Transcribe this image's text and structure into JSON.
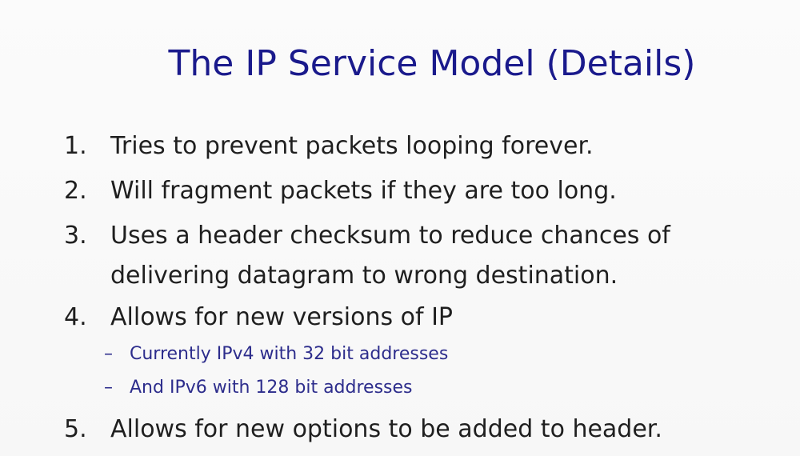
{
  "slide": {
    "title": "The IP Service Model (Details)",
    "items": [
      {
        "number": "1.",
        "text": "Tries to prevent packets looping forever."
      },
      {
        "number": "2.",
        "text": "Will fragment packets if they are too long."
      },
      {
        "number": "3.",
        "lines": [
          "Uses a header checksum to reduce chances of",
          "delivering datagram to wrong destination."
        ]
      },
      {
        "number": "4.",
        "text": "Allows for new versions of IP"
      },
      {
        "number": "5.",
        "text": "Allows for new options to be added to header."
      }
    ],
    "sub_items": [
      {
        "dash": "–",
        "text": "Currently IPv4 with 32 bit addresses"
      },
      {
        "dash": "–",
        "text": "And IPv6 with 128 bit addresses"
      }
    ]
  }
}
